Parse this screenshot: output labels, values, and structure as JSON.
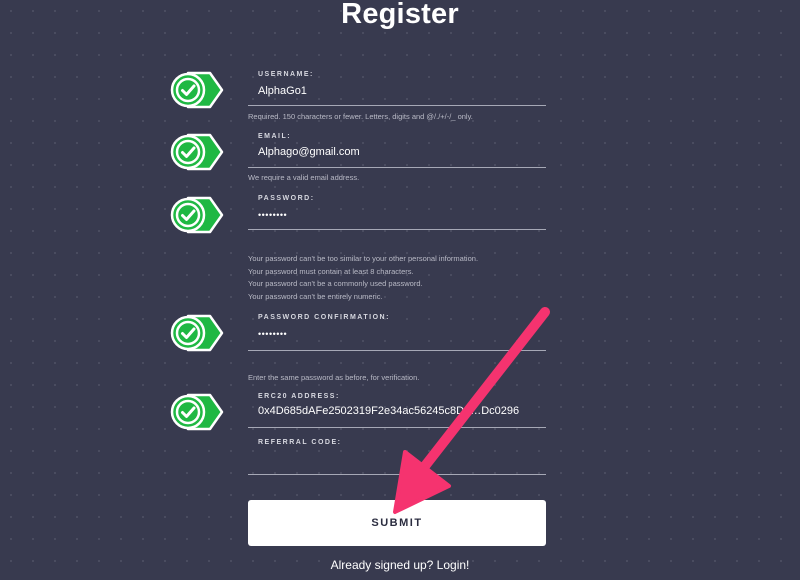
{
  "page": {
    "title": "Register",
    "login_link": "Already signed up? Login!"
  },
  "form": {
    "username": {
      "label": "USERNAME:",
      "value": "AlphaGo1",
      "help": "Required. 150 characters or fewer. Letters, digits and @/./+/-/_ only."
    },
    "email": {
      "label": "EMAIL:",
      "value": "Alphago@gmail.com",
      "help": "We require a valid email address."
    },
    "password": {
      "label": "PASSWORD:",
      "value": "••••••••",
      "help": [
        "Your password can't be too similar to your other personal information.",
        "Your password must contain at least 8 characters.",
        "Your password can't be a commonly used password.",
        "Your password can't be entirely numeric."
      ]
    },
    "password_confirmation": {
      "label": "PASSWORD CONFIRMATION:",
      "value": "••••••••",
      "help": "Enter the same password as before, for verification."
    },
    "erc20_address": {
      "label": "ERC20 ADDRESS:",
      "value": "0x4D685dAFe2502319F2e34ac56245c8D8…Dc0296"
    },
    "referral_code": {
      "label": "REFERRAL CODE:",
      "value": ""
    },
    "submit_label": "SUBMIT"
  },
  "icons": {
    "check": "check-badge-icon",
    "arrow": "pointer-arrow-icon"
  },
  "colors": {
    "background": "#383a4f",
    "check_green": "#1fb843",
    "arrow_pink": "#f5336f",
    "button": "#ffffff",
    "button_text": "#2b2d40"
  }
}
